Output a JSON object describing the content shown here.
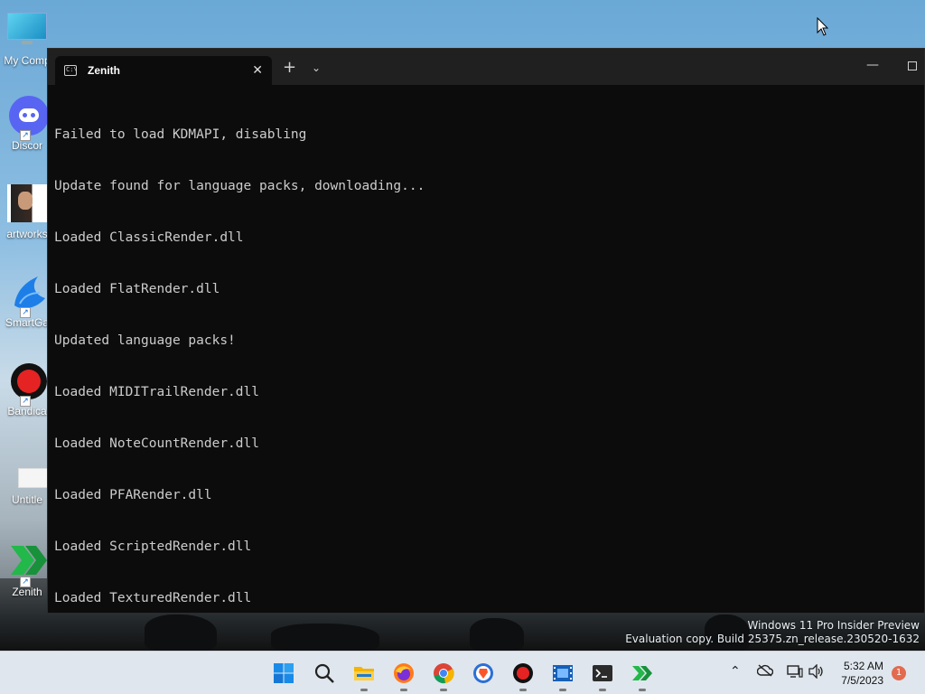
{
  "desktop": {
    "icons": [
      {
        "label": "My Comp",
        "icon": "monitor-icon"
      },
      {
        "label": "Discor",
        "icon": "discord-icon"
      },
      {
        "label": "artworks",
        "icon": "image-thumbnail-icon"
      },
      {
        "label": "SmartGa",
        "icon": "smartgaga-icon"
      },
      {
        "label": "Bandica",
        "icon": "bandicam-icon"
      },
      {
        "label": "Untitle",
        "icon": "blank-file-icon"
      },
      {
        "label": "Zenith",
        "icon": "zenith-icon"
      }
    ],
    "watermark_line1": "Windows 11 Pro Insider Preview",
    "watermark_line2": "Evaluation copy. Build 25375.zn_release.230520-1632"
  },
  "terminal": {
    "tab_title": "Zenith",
    "tab_close": "✕",
    "new_tab": "+",
    "dropdown": "⌄",
    "minimize": "—",
    "lines": [
      "Failed to load KDMAPI, disabling",
      "Update found for language packs, downloading...",
      "Loaded ClassicRender.dll",
      "Loaded FlatRender.dll",
      "Updated language packs!",
      "Loaded MIDITrailRender.dll",
      "Loaded NoteCountRender.dll",
      "Loaded PFARender.dll",
      "Loaded ScriptedRender.dll",
      "Loaded TexturedRender.dll"
    ]
  },
  "taskbar": {
    "apps": [
      {
        "name": "start",
        "icon": "windows-start-icon"
      },
      {
        "name": "search",
        "icon": "search-icon"
      },
      {
        "name": "file-explorer",
        "icon": "folder-icon"
      },
      {
        "name": "firefox",
        "icon": "firefox-icon"
      },
      {
        "name": "chrome",
        "icon": "chrome-icon"
      },
      {
        "name": "brave",
        "icon": "brave-icon"
      },
      {
        "name": "bandicam",
        "icon": "record-icon"
      },
      {
        "name": "media",
        "icon": "film-icon"
      },
      {
        "name": "terminal",
        "icon": "terminal-icon"
      },
      {
        "name": "zenith",
        "icon": "zenith-icon"
      }
    ],
    "time": "5:32 AM",
    "date": "7/5/2023",
    "notification_count": "1"
  },
  "colors": {
    "terminal_bg": "#0c0c0c",
    "terminal_text": "#cccccc",
    "titlebar": "#202020",
    "taskbar": "#dfe6ee",
    "accent": "#0078d4"
  }
}
